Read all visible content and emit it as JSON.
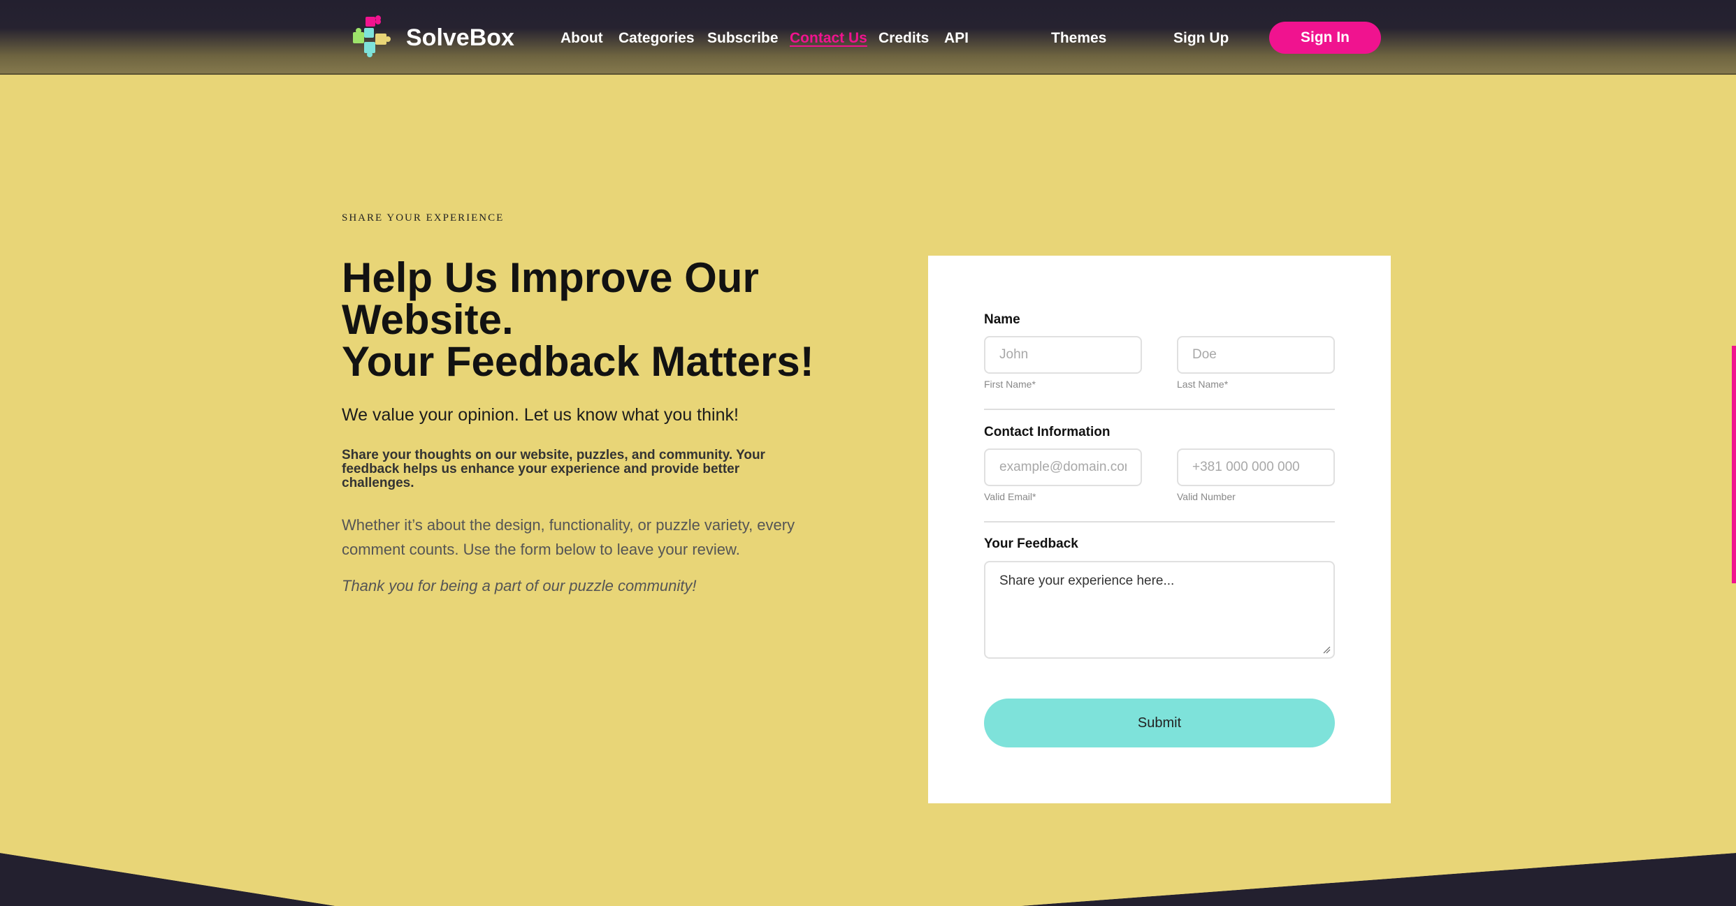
{
  "brand": {
    "name": "SolveBox",
    "tagline": "",
    "accent": "#f0138f",
    "background": "#e8d577",
    "dark": "#23202f",
    "button": "#7ee2da"
  },
  "nav": {
    "items": [
      {
        "label": "About"
      },
      {
        "label": "Categories"
      },
      {
        "label": "Subscribe"
      },
      {
        "label": "Contact Us",
        "active": true
      },
      {
        "label": "Credits"
      },
      {
        "label": "API"
      },
      {
        "label": "Themes"
      },
      {
        "label": "Sign Up"
      }
    ],
    "signin_label": "Sign In"
  },
  "intro": {
    "eyebrow": "SHARE YOUR EXPERIENCE",
    "headline_line1": "Help Us Improve Our",
    "headline_line2": "Website.",
    "headline_line3": "Your Feedback Matters!",
    "lead": "We value your opinion. Let us know what you think!",
    "bold_paragraph": "Share your thoughts on our website, puzzles, and community. Your feedback helps us enhance your experience and provide better challenges.",
    "plain_paragraph": "Whether it’s about the design, functionality, or puzzle variety, every comment counts. Use the form below to leave your review.",
    "italic_paragraph": "Thank you for being a part of our puzzle community!"
  },
  "form": {
    "name_label": "Name",
    "first_name": {
      "placeholder": "John",
      "value": "",
      "hint": "First Name*"
    },
    "last_name": {
      "placeholder": "Doe",
      "value": "",
      "hint": "Last Name*"
    },
    "contact_label": "Contact Information",
    "email": {
      "placeholder": "example@domain.com",
      "value": "",
      "hint": "Valid Email*"
    },
    "phone": {
      "placeholder": "+381 000 000 000",
      "value": "",
      "hint": "Valid Number"
    },
    "feedback_label": "Your Feedback",
    "feedback": {
      "placeholder": "Share your experience here...",
      "value": ""
    },
    "submit_label": "Submit"
  },
  "icons": {
    "logo": "puzzle-pieces-logo-icon",
    "resize": "resize-grip-icon"
  }
}
